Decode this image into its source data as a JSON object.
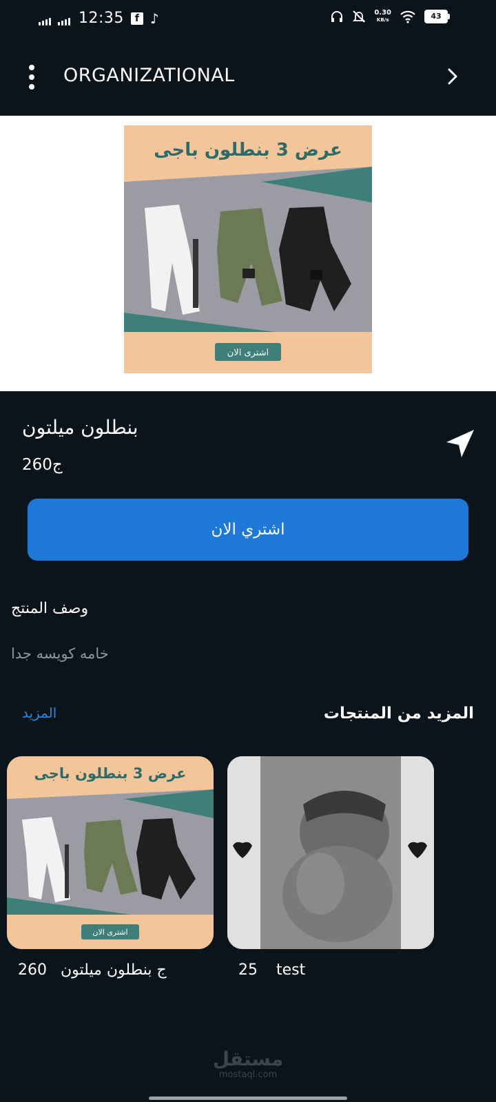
{
  "status_bar": {
    "time": "12:35",
    "net_speed_value": "0.30",
    "net_speed_unit": "KB/s",
    "battery_level": "43",
    "app_icons": [
      "facebook-icon",
      "tiktok-icon"
    ]
  },
  "app_bar": {
    "title": "ORGANIZATIONAL"
  },
  "hero": {
    "banner_headline": "عرض 3 بنطلون باجى",
    "banner_button": "اشترى الان"
  },
  "product": {
    "name": "بنطلون ميلتون",
    "price": "260ج",
    "buy_button_label": "اشتري الان"
  },
  "description": {
    "title": "وصف المنتج",
    "text": "خامه كويسه جدا"
  },
  "more_products": {
    "title": "المزيد من المنتجات",
    "more_link": "المزيد",
    "items": [
      {
        "name": "بنطلون ميلتون",
        "price": "260ج",
        "banner_headline": "عرض 3 بنطلون باجى",
        "banner_button": "اشترى الان"
      },
      {
        "name": "test",
        "price": "25"
      }
    ]
  },
  "watermark": {
    "arabic": "مستقل",
    "latin": "mostaql.com"
  },
  "colors": {
    "background": "#0b141b",
    "accent": "#1e78d7",
    "link": "#2a86e0"
  }
}
